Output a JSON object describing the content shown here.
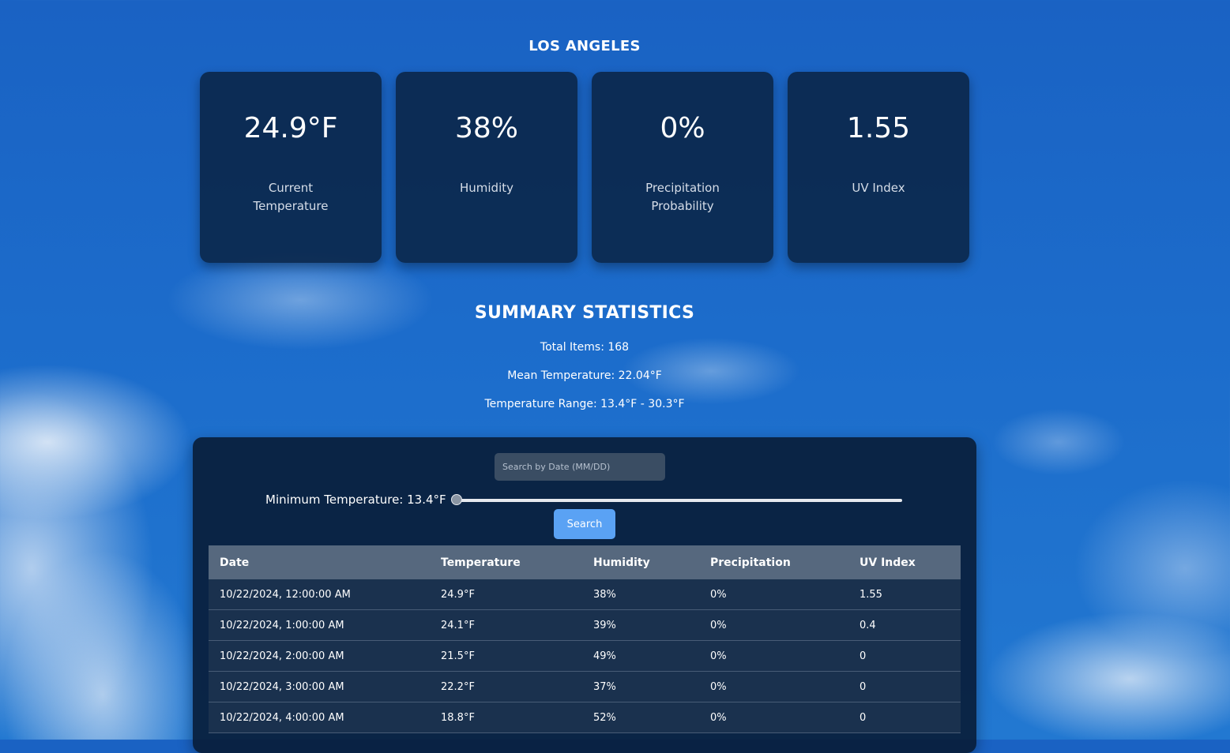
{
  "location": {
    "name": "LOS ANGELES"
  },
  "cards": [
    {
      "value": "24.9°F",
      "label": "Current Temperature"
    },
    {
      "value": "38%",
      "label": "Humidity"
    },
    {
      "value": "0%",
      "label": "Precipitation Probability"
    },
    {
      "value": "1.55",
      "label": "UV Index"
    }
  ],
  "summary": {
    "title": "SUMMARY STATISTICS",
    "total_items": "Total Items: 168",
    "mean_temperature": "Mean Temperature: 22.04°F",
    "temperature_range": "Temperature Range: 13.4°F - 30.3°F"
  },
  "filters": {
    "search_placeholder": "Search by Date (MM/DD)",
    "search_value": "",
    "slider_label": "Minimum Temperature: 13.4°F",
    "slider_value_fraction": 0,
    "search_button": "Search"
  },
  "table": {
    "headers": [
      "Date",
      "Temperature",
      "Humidity",
      "Precipitation",
      "UV Index"
    ],
    "rows": [
      [
        "10/22/2024, 12:00:00 AM",
        "24.9°F",
        "38%",
        "0%",
        "1.55"
      ],
      [
        "10/22/2024, 1:00:00 AM",
        "24.1°F",
        "39%",
        "0%",
        "0.4"
      ],
      [
        "10/22/2024, 2:00:00 AM",
        "21.5°F",
        "49%",
        "0%",
        "0"
      ],
      [
        "10/22/2024, 3:00:00 AM",
        "22.2°F",
        "37%",
        "0%",
        "0"
      ],
      [
        "10/22/2024, 4:00:00 AM",
        "18.8°F",
        "52%",
        "0%",
        "0"
      ]
    ]
  }
}
